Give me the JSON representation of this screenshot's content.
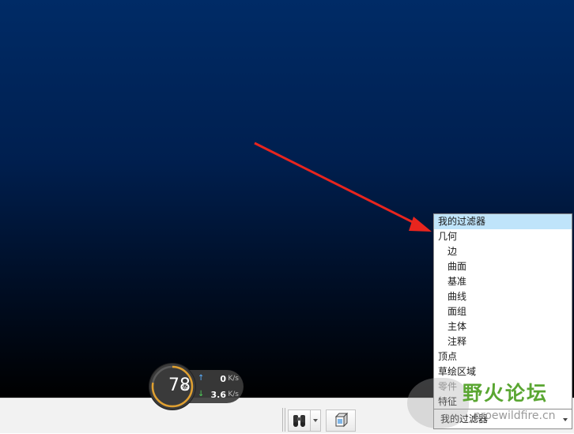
{
  "filter_list": {
    "items": [
      {
        "label": "我的过滤器",
        "selected": true
      },
      {
        "label": "几何"
      },
      {
        "label": "边",
        "indent": true
      },
      {
        "label": "曲面",
        "indent": true
      },
      {
        "label": "基准",
        "indent": true
      },
      {
        "label": "曲线",
        "indent": true
      },
      {
        "label": "面组",
        "indent": true
      },
      {
        "label": "主体",
        "indent": true
      },
      {
        "label": "注释",
        "indent": true
      },
      {
        "label": "顶点"
      },
      {
        "label": "草绘区域"
      },
      {
        "label": "零件",
        "gray": true
      },
      {
        "label": "特征"
      }
    ]
  },
  "filter_combo": {
    "value": "我的过滤器"
  },
  "net_widget": {
    "percent": "78",
    "percent_sign": "%",
    "percent_fraction": 0.78,
    "upload_value": "0",
    "download_value": "3.6",
    "unit": "K/s"
  },
  "watermark": {
    "title": "野火论坛",
    "url": "proewildfire.cn"
  },
  "colors": {
    "viewport_top": "#002b66",
    "viewport_bottom": "#000000",
    "selected_row": "#bfe4fa",
    "annotation_arrow": "#e8251e"
  },
  "icons": {
    "find": "binoculars-icon",
    "view": "cube-view-icon"
  }
}
